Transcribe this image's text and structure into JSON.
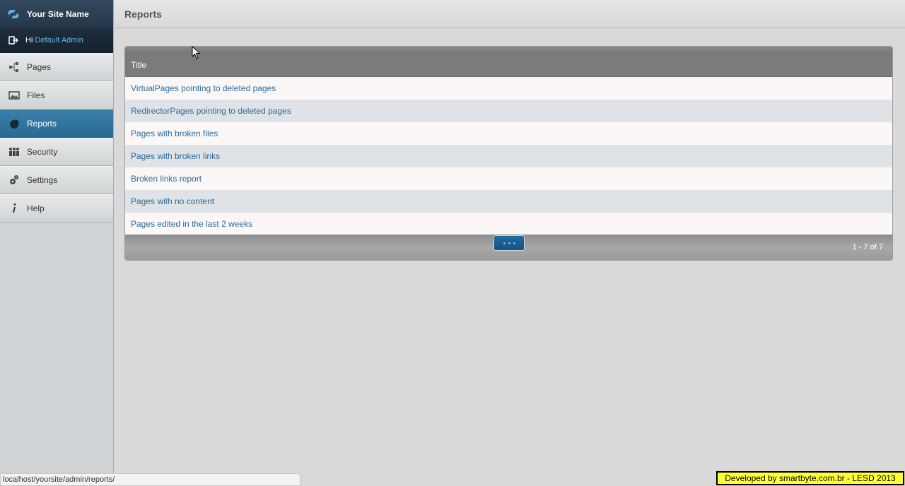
{
  "brand": {
    "site_name": "Your Site Name"
  },
  "user": {
    "greeting": "Hi",
    "name": "Default Admin"
  },
  "sidebar": {
    "items": [
      {
        "label": "Pages",
        "icon": "sitemap-icon",
        "active": false
      },
      {
        "label": "Files",
        "icon": "image-icon",
        "active": false
      },
      {
        "label": "Reports",
        "icon": "pie-chart-icon",
        "active": true
      },
      {
        "label": "Security",
        "icon": "users-icon",
        "active": false
      },
      {
        "label": "Settings",
        "icon": "gear-icon",
        "active": false
      },
      {
        "label": "Help",
        "icon": "info-icon",
        "active": false
      }
    ]
  },
  "header": {
    "title": "Reports"
  },
  "grid": {
    "column_title": "Title",
    "rows": [
      "VirtualPages pointing to deleted pages",
      "RedirectorPages pointing to deleted pages",
      "Pages with broken files",
      "Pages with broken links",
      "Broken links report",
      "Pages with no content",
      "Pages edited in the last 2 weeks"
    ],
    "pagination": "1 - 7 of 7"
  },
  "statusbar": {
    "url": "localhost/yoursite/admin/reports/"
  },
  "credit": {
    "text": "Developed by smartbyte.com.br - LESD 2013"
  },
  "colors": {
    "accent": "#2a6a92",
    "link": "#2b6a9a",
    "credit_bg": "#ffff33"
  }
}
